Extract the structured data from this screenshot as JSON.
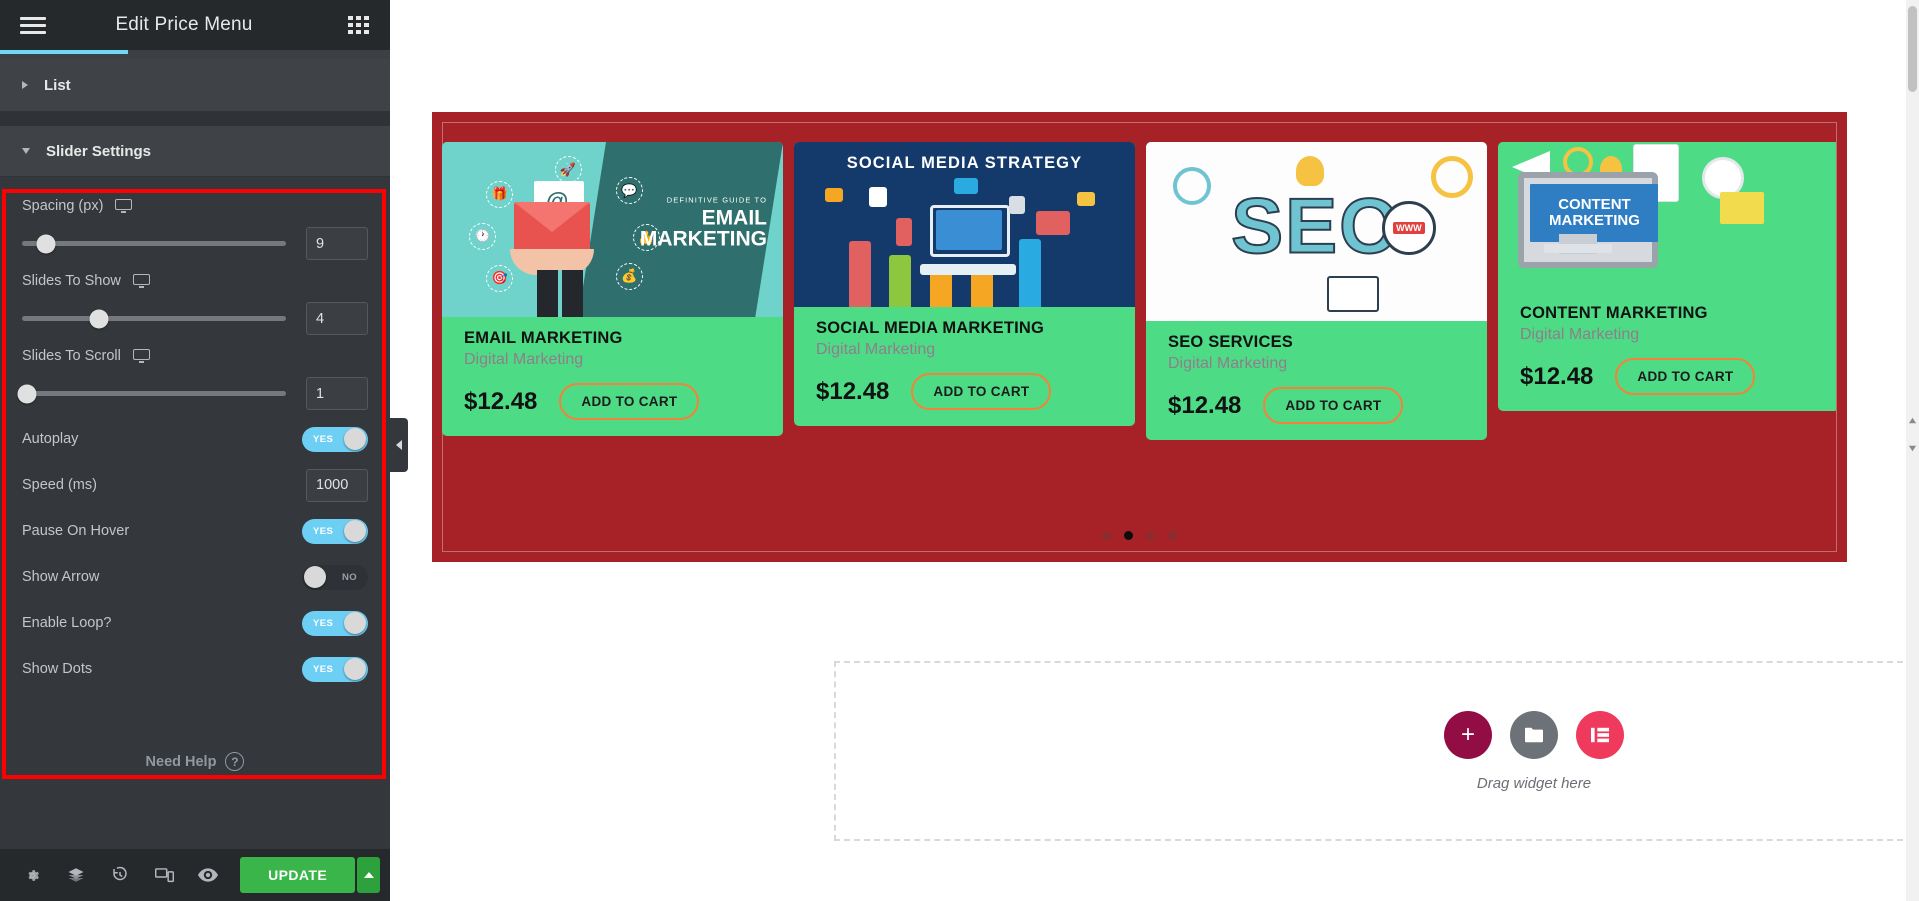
{
  "panel": {
    "title": "Edit Price Menu",
    "menu_icon": "hamburger-icon",
    "apps_icon": "grid-apps-icon",
    "sections": {
      "list": {
        "label": "List",
        "expanded": false
      },
      "slider": {
        "label": "Slider Settings",
        "expanded": true
      }
    },
    "controls": [
      {
        "type": "slider",
        "label": "Spacing (px)",
        "value": "9",
        "knob_pct": 9,
        "device": "desktop-icon"
      },
      {
        "type": "slider",
        "label": "Slides To Show",
        "value": "4",
        "knob_pct": 29,
        "device": "desktop-icon"
      },
      {
        "type": "slider",
        "label": "Slides To Scroll",
        "value": "1",
        "knob_pct": 2,
        "device": "desktop-icon"
      },
      {
        "type": "toggle",
        "label": "Autoplay",
        "value": "YES",
        "on": true
      },
      {
        "type": "number",
        "label": "Speed (ms)",
        "value": "1000"
      },
      {
        "type": "toggle",
        "label": "Pause On Hover",
        "value": "YES",
        "on": true
      },
      {
        "type": "toggle",
        "label": "Show Arrow",
        "value": "NO",
        "on": false
      },
      {
        "type": "toggle",
        "label": "Enable Loop?",
        "value": "YES",
        "on": true
      },
      {
        "type": "toggle",
        "label": "Show Dots",
        "value": "YES",
        "on": true
      }
    ],
    "need_help": {
      "label": "Need Help",
      "icon": "question-mark-icon"
    },
    "bottom_bar": {
      "icons": [
        "settings-gear-icon",
        "layers-icon",
        "history-revisions-icon",
        "responsive-mode-icon",
        "preview-eye-icon"
      ],
      "update_label": "UPDATE",
      "update_caret": "chevron-up-icon"
    },
    "collapse_handle": "panel-collapse-arrow-icon"
  },
  "canvas": {
    "cards": [
      {
        "art": "email-marketing-illustration",
        "art_eyebrow": "DEFINITIVE GUIDE TO",
        "art_title_line1": "EMAIL",
        "art_title_line2": "MARKETING",
        "title": "EMAIL MARKETING",
        "subtitle": "Digital Marketing",
        "price": "$12.48",
        "cta": "ADD TO CART"
      },
      {
        "art": "social-media-strategy-illustration",
        "art_title": "SOCIAL MEDIA STRATEGY",
        "title": "SOCIAL MEDIA MARKETING",
        "subtitle": "Digital Marketing",
        "price": "$12.48",
        "cta": "ADD TO CART"
      },
      {
        "art": "seo-illustration",
        "art_title": "SEO",
        "title": "SEO SERVICES",
        "subtitle": "Digital Marketing",
        "price": "$12.48",
        "cta": "ADD TO CART"
      },
      {
        "art": "content-marketing-illustration",
        "art_title_line1": "CONTENT",
        "art_title_line2": "MARKETING",
        "title": "CONTENT MARKETING",
        "subtitle": "Digital Marketing",
        "price": "$12.48",
        "cta": "ADD TO CART"
      }
    ],
    "pagination": {
      "count": 4,
      "active_index": 1
    },
    "drop_zone": {
      "text": "Drag widget here",
      "buttons": [
        "add-new-section-icon",
        "add-template-folder-icon",
        "elementor-library-icon"
      ]
    }
  },
  "colors": {
    "accent_blue": "#6ecff5",
    "update_green": "#39b54a",
    "highlight_red": "#ff0000",
    "section_red": "#a62226",
    "card_green": "#4ddb86",
    "cta_orange": "#f58238"
  }
}
